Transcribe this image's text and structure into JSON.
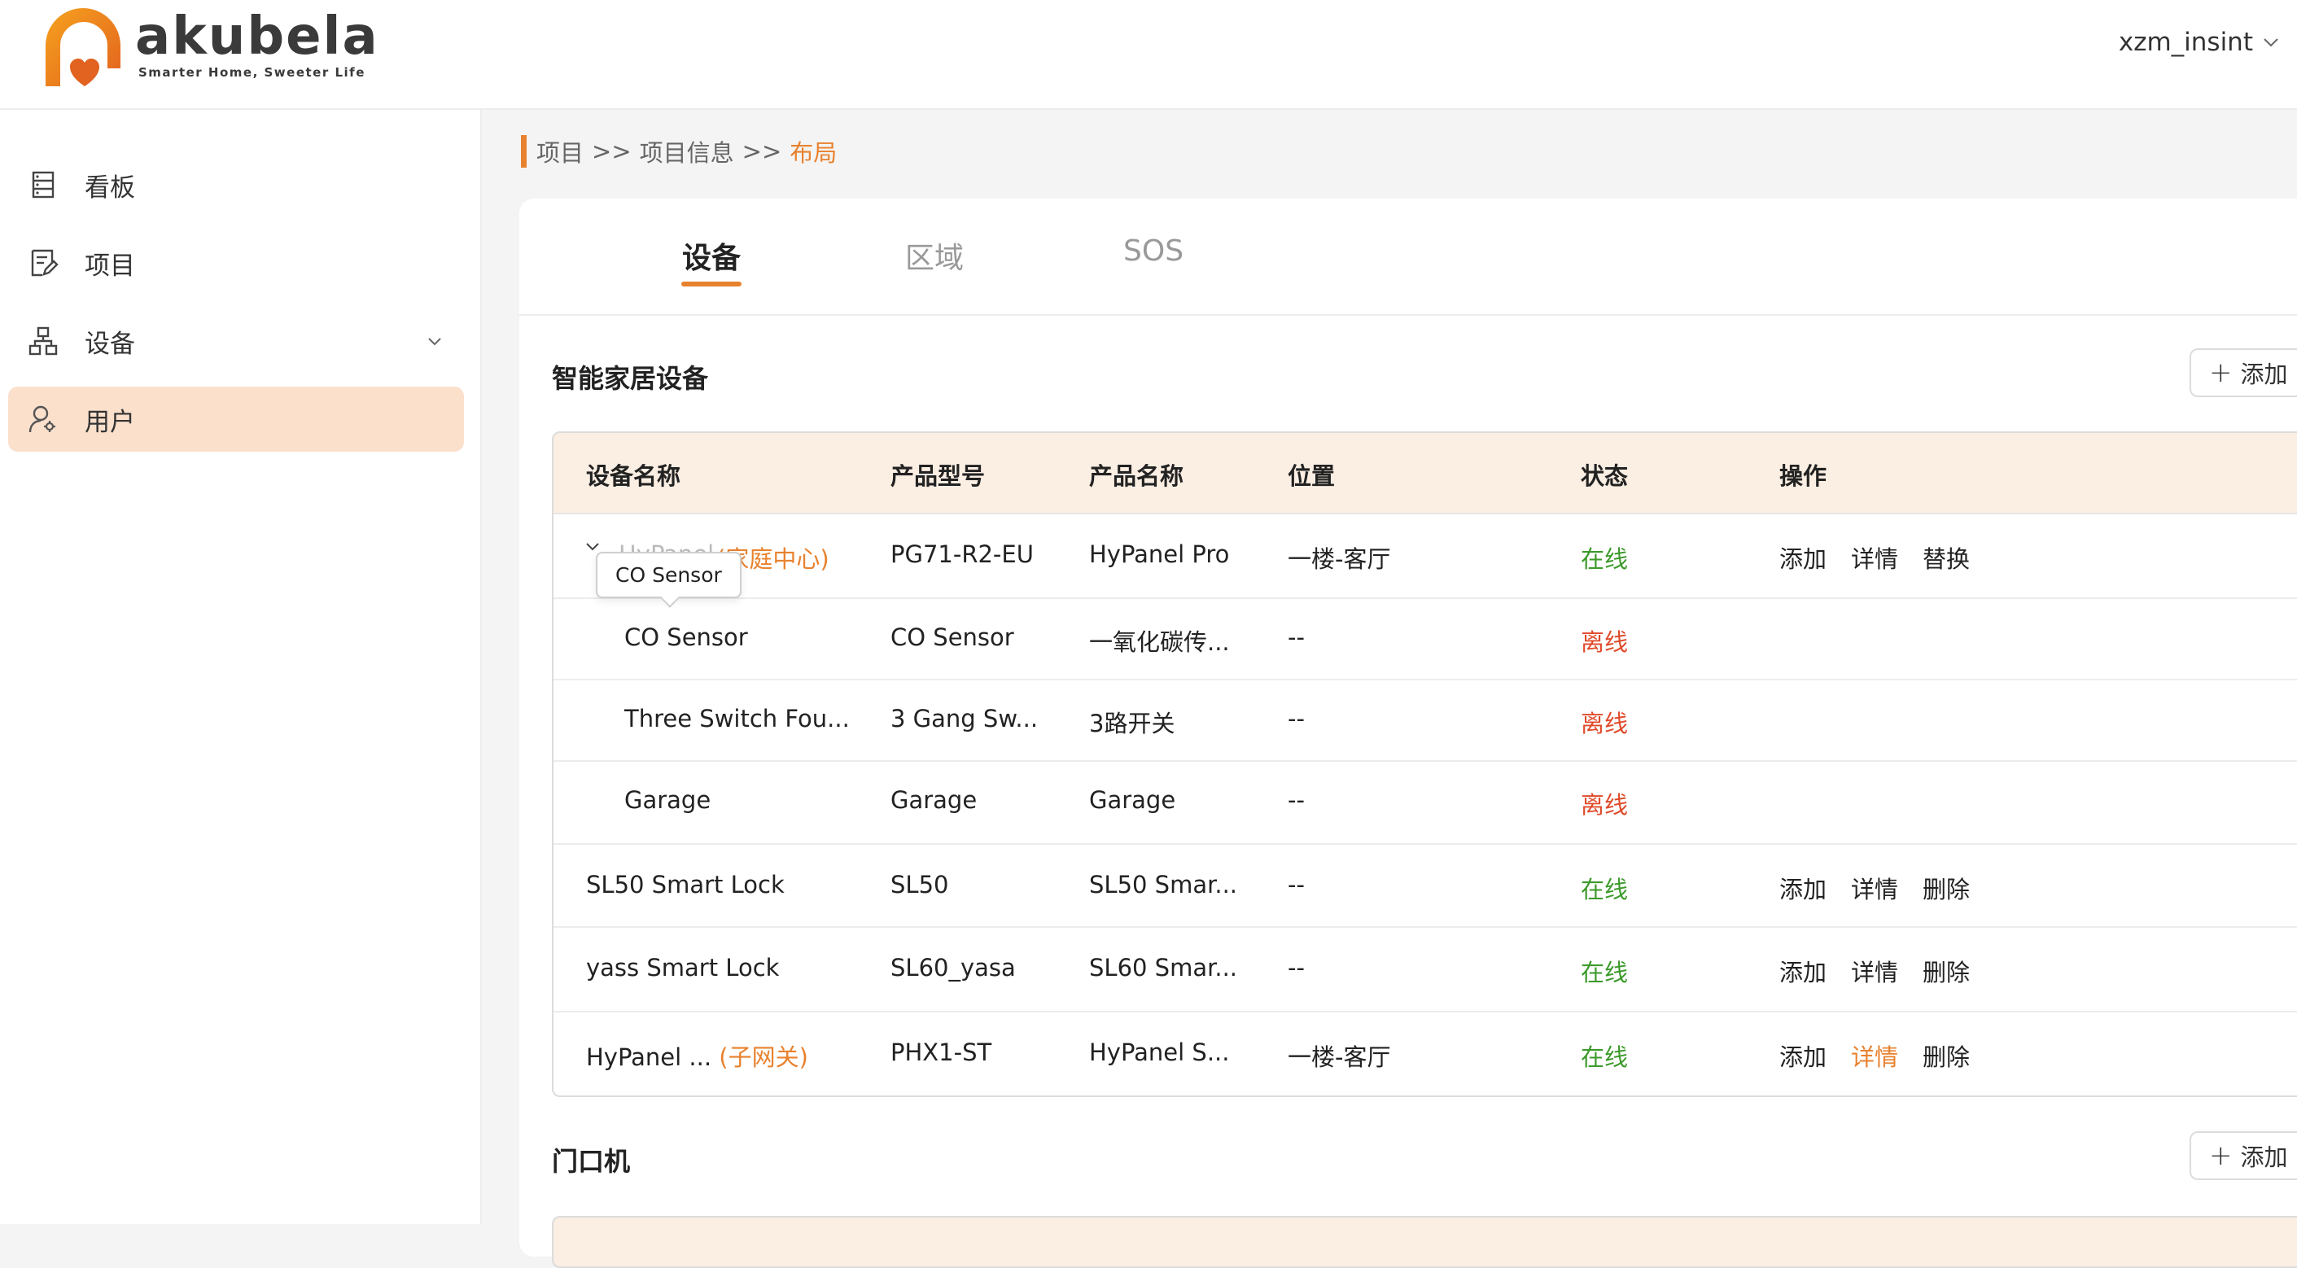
{
  "header": {
    "logo_text": "akubela",
    "logo_tagline": "Smarter Home, Sweeter Life",
    "username": "xzm_insint"
  },
  "sidebar": {
    "items": [
      {
        "label": "看板",
        "icon": "dashboard-icon"
      },
      {
        "label": "项目",
        "icon": "project-icon"
      },
      {
        "label": "设备",
        "icon": "device-network-icon"
      },
      {
        "label": "用户",
        "icon": "user-icon"
      }
    ]
  },
  "breadcrumb": [
    "项目",
    "项目信息",
    "布局"
  ],
  "breadcrumb_sep": ">>",
  "tabs": [
    "设备",
    "区域",
    "SOS"
  ],
  "sections": [
    {
      "title": "智能家居设备",
      "add_label": "添加"
    },
    {
      "title": "门口机",
      "add_label": "添加"
    }
  ],
  "table": {
    "columns": [
      "设备名称",
      "产品型号",
      "产品名称",
      "位置",
      "状态",
      "操作"
    ],
    "tooltip": "CO Sensor",
    "rows": [
      {
        "name": "HyPanel",
        "tag": "(家庭中心)",
        "model": "PG71-R2-EU",
        "product": "HyPanel Pro",
        "location": "一楼-客厅",
        "status": "在线",
        "ops": [
          "添加",
          "详情",
          "替换"
        ]
      },
      {
        "name": "CO Sensor",
        "tag": "",
        "model": "CO Sensor",
        "product": "一氧化碳传...",
        "location": "--",
        "status": "离线",
        "ops": []
      },
      {
        "name": "Three Switch Fou...",
        "tag": "",
        "model": "3 Gang Sw...",
        "product": "3路开关",
        "location": "--",
        "status": "离线",
        "ops": []
      },
      {
        "name": "Garage",
        "tag": "",
        "model": "Garage",
        "product": "Garage",
        "location": "--",
        "status": "离线",
        "ops": []
      },
      {
        "name": "SL50 Smart Lock",
        "tag": "",
        "model": "SL50",
        "product": "SL50 Smar...",
        "location": "--",
        "status": "在线",
        "ops": [
          "添加",
          "详情",
          "删除"
        ]
      },
      {
        "name": "yass Smart Lock",
        "tag": "",
        "model": "SL60_yasa",
        "product": "SL60 Smar...",
        "location": "--",
        "status": "在线",
        "ops": [
          "添加",
          "详情",
          "删除"
        ]
      },
      {
        "name": "HyPanel ...",
        "tag": "(子网关)",
        "model": "PHX1-ST",
        "product": "HyPanel S...",
        "location": "一楼-客厅",
        "status": "在线",
        "ops": [
          "添加",
          "详情",
          "删除"
        ]
      }
    ]
  },
  "colors": {
    "accent": "#e8822e",
    "online": "#3c9a2a",
    "offline": "#e04a2a",
    "active_nav_bg": "#fbe0cc",
    "table_header_bg": "#fbeee3"
  }
}
